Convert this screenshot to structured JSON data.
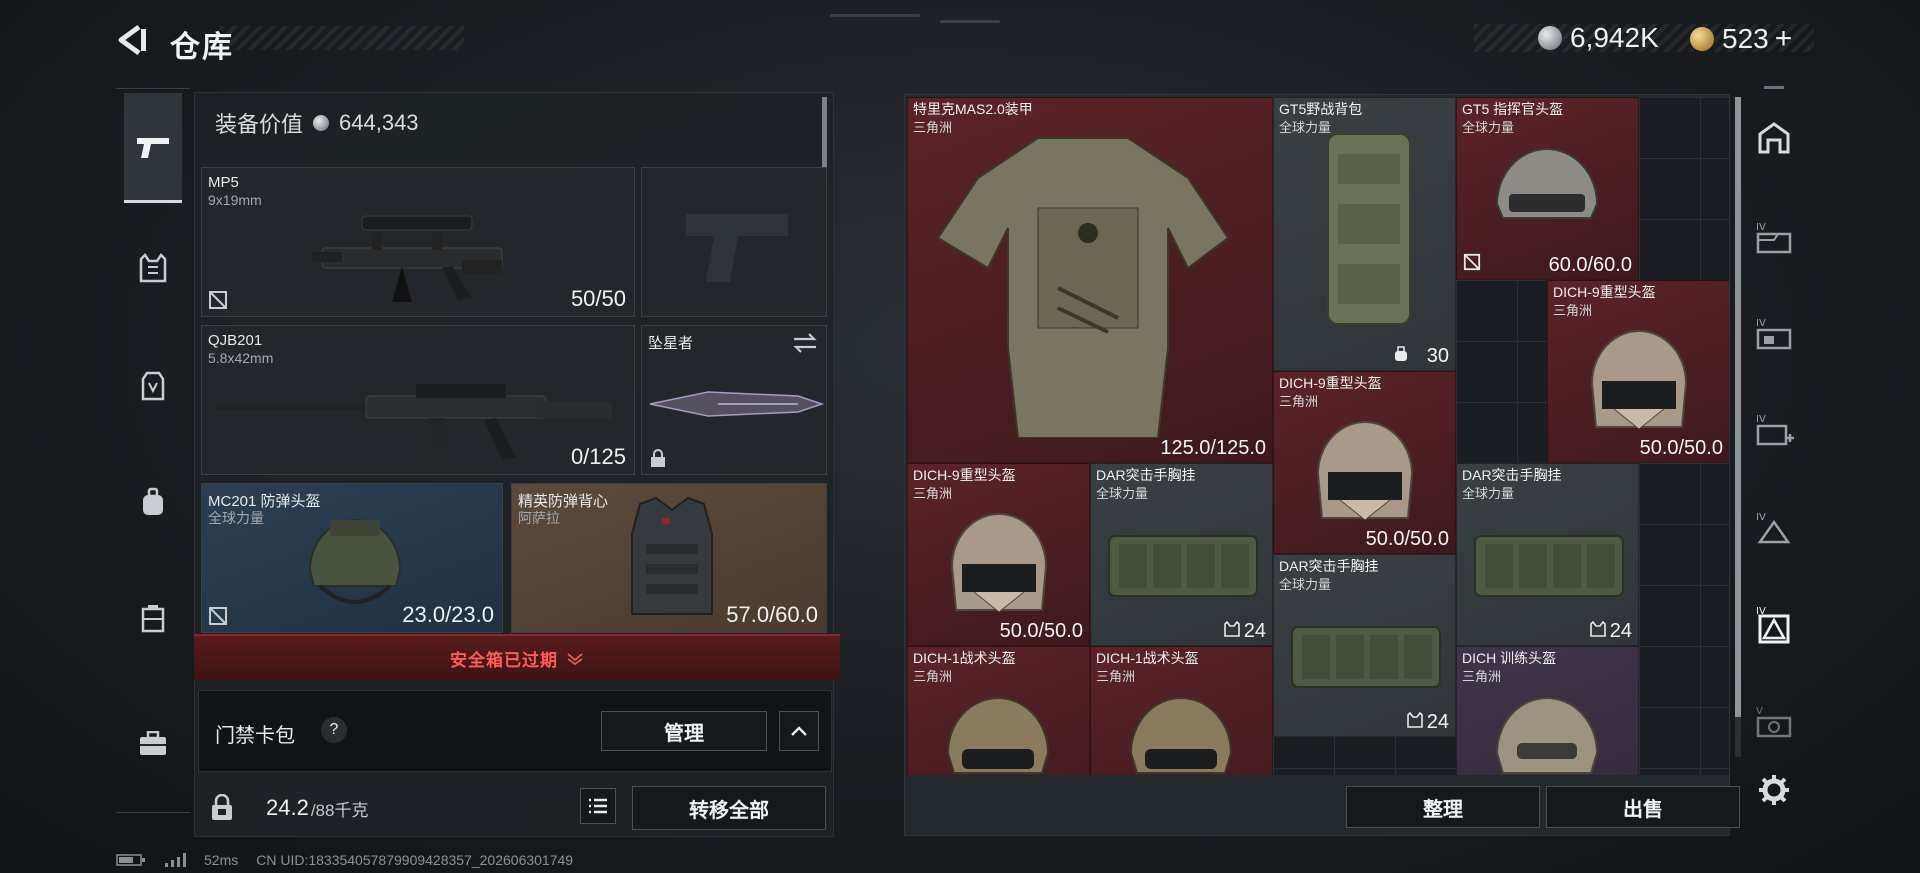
{
  "header": {
    "title": "仓库",
    "currencies": [
      {
        "icon": "silver-coin-icon",
        "value": "6,942K"
      },
      {
        "icon": "gold-coin-icon",
        "value": "523",
        "add": "+"
      }
    ]
  },
  "left_nav": {
    "items": [
      {
        "name": "weapons",
        "icon": "pistol-icon",
        "active": true
      },
      {
        "name": "armor",
        "icon": "armor-vest-icon"
      },
      {
        "name": "chest-rig",
        "icon": "chest-rig-icon"
      },
      {
        "name": "backpack",
        "icon": "backpack-icon"
      },
      {
        "name": "container",
        "icon": "container-icon"
      },
      {
        "name": "case",
        "icon": "briefcase-icon"
      }
    ]
  },
  "loadout": {
    "equip_value_label": "装备价值",
    "equip_value": "644,343",
    "slots": [
      {
        "id": "primary",
        "name": "MP5",
        "sub": "9x19mm",
        "value": "50/50"
      },
      {
        "id": "secondary",
        "name": "QJB201",
        "sub": "5.8x42mm",
        "value": "0/125"
      },
      {
        "id": "melee",
        "name": "坠星者"
      },
      {
        "id": "helmet",
        "name": "MC201 防弹头盔",
        "sub": "全球力量",
        "value": "23.0/23.0"
      },
      {
        "id": "armor",
        "name": "精英防弹背心",
        "sub": "阿萨拉",
        "value": "57.0/60.0"
      }
    ],
    "expired_text": "安全箱已过期",
    "card_pack_label": "门禁卡包",
    "help": "?",
    "manage_label": "管理",
    "weight": "24.2",
    "weight_max": "/88千克",
    "transfer_all_label": "转移全部"
  },
  "stash": {
    "items": [
      {
        "name": "特里克MAS2.0装甲",
        "sub": "三角洲",
        "value": "125.0/125.0",
        "color": "red"
      },
      {
        "name": "GT5野战背包",
        "sub": "全球力量",
        "value": "30",
        "color": "grey"
      },
      {
        "name": "GT5 指挥官头盔",
        "sub": "全球力量",
        "value": "60.0/60.0",
        "color": "red"
      },
      {
        "name": "DICH-9重型头盔",
        "sub": "三角洲",
        "value": "50.0/50.0",
        "color": "red"
      },
      {
        "name": "DICH-9重型头盔",
        "sub": "三角洲",
        "value": "50.0/50.0",
        "color": "red"
      },
      {
        "name": "DICH-9重型头盔",
        "sub": "三角洲",
        "value": "50.0/50.0",
        "color": "red"
      },
      {
        "name": "DAR突击手胸挂",
        "sub": "全球力量",
        "value": "24",
        "color": "grey"
      },
      {
        "name": "DAR突击手胸挂",
        "sub": "全球力量",
        "value": "24",
        "color": "grey"
      },
      {
        "name": "DAR突击手胸挂",
        "sub": "全球力量",
        "value": "24",
        "color": "grey"
      },
      {
        "name": "DICH-1战术头盔",
        "sub": "三角洲",
        "value": "",
        "color": "red"
      },
      {
        "name": "DICH-1战术头盔",
        "sub": "三角洲",
        "value": "",
        "color": "red"
      },
      {
        "name": "DICH 训练头盔",
        "sub": "三角洲",
        "value": "",
        "color": "purple"
      }
    ],
    "sort_label": "整理",
    "sell_label": "出售"
  },
  "right_nav": {
    "items": [
      {
        "icon": "warehouse-icon"
      },
      {
        "icon": "storage-iv-1-icon"
      },
      {
        "icon": "storage-iv-2-icon"
      },
      {
        "icon": "storage-iv-add-icon"
      },
      {
        "icon": "storage-iv-3-icon"
      },
      {
        "icon": "storage-iv-active-icon",
        "active": true
      },
      {
        "icon": "storage-v-icon"
      },
      {
        "icon": "settings-gear-icon"
      }
    ]
  },
  "status": {
    "ping": "52ms",
    "uid": "CN UID:18335405787990942835​7_202606301749"
  }
}
